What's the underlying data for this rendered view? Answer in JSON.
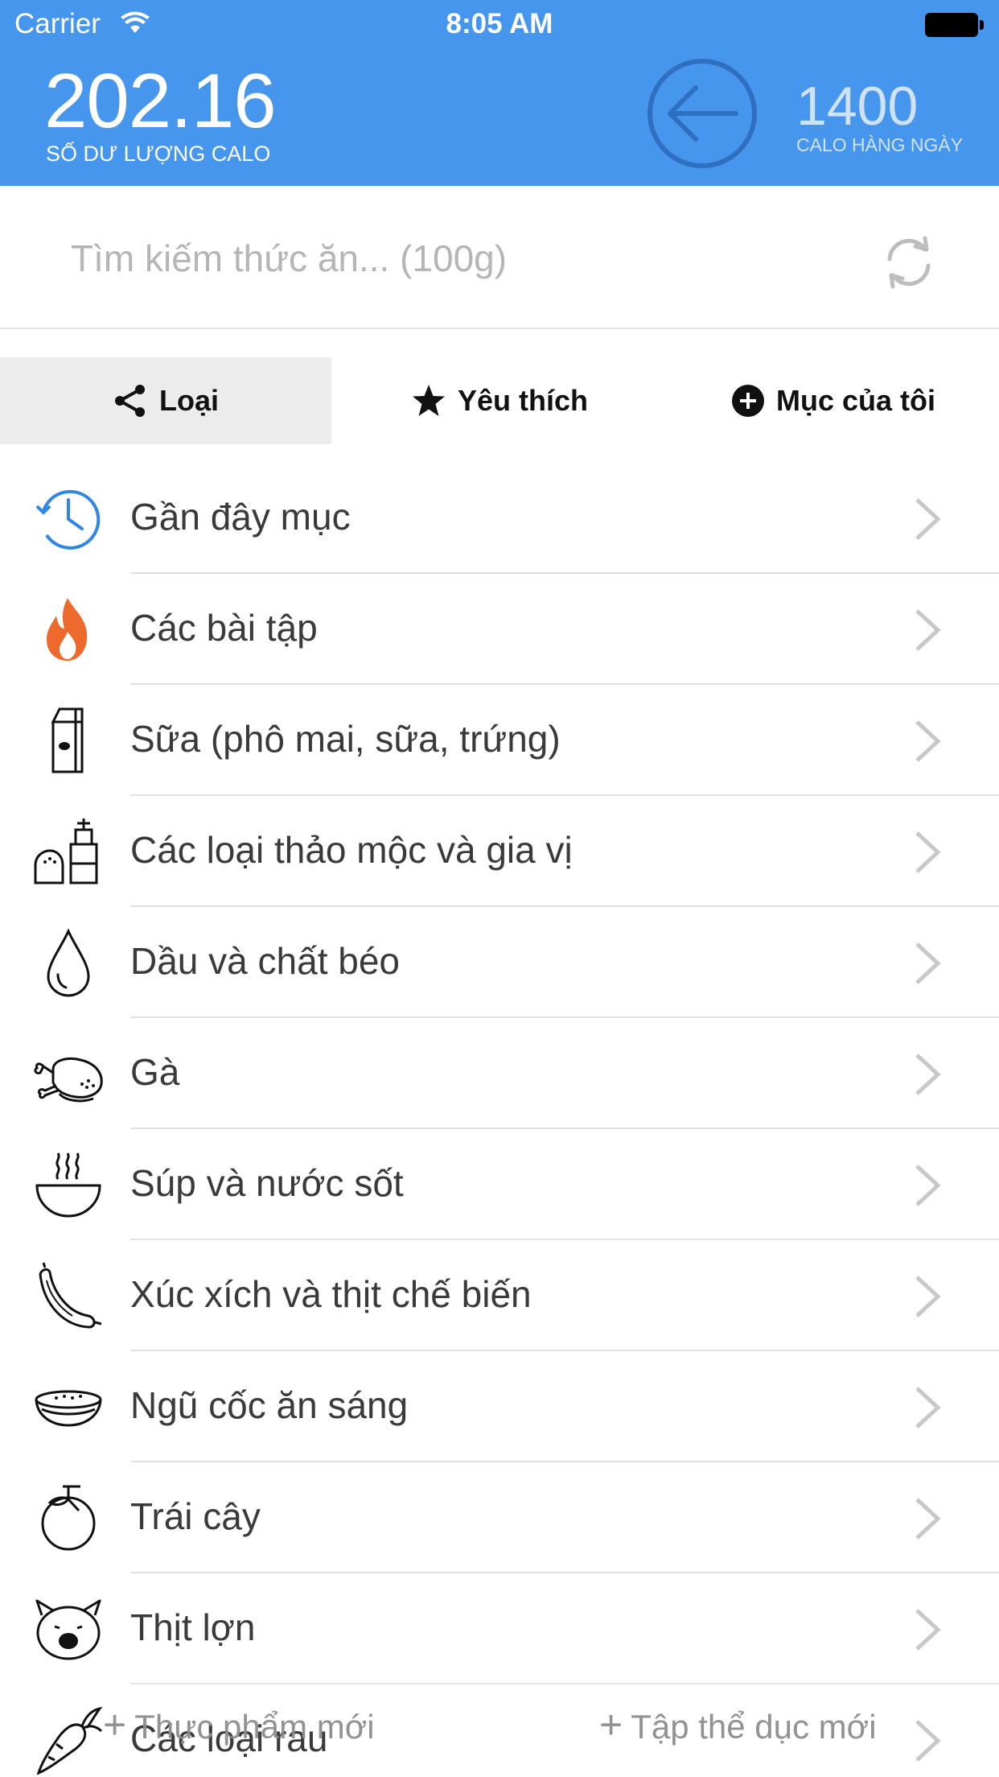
{
  "status_bar": {
    "carrier": "Carrier",
    "time": "8:05 AM"
  },
  "header": {
    "balance_value": "202.16",
    "balance_label": "SỐ DƯ LƯỢNG CALO",
    "daily_value": "1400",
    "daily_label": "CALO HÀNG NGÀY",
    "accent_color": "#4796ee"
  },
  "search": {
    "placeholder": "Tìm kiếm thức ăn... (100g)",
    "value": ""
  },
  "tabs": [
    {
      "label": "Loại",
      "icon": "share-icon",
      "active": true
    },
    {
      "label": "Yêu thích",
      "icon": "star-icon",
      "active": false
    },
    {
      "label": "Mục của tôi",
      "icon": "plus-circle-icon",
      "active": false
    }
  ],
  "categories": [
    {
      "label": "Gần đây mục",
      "icon": "history-clock-icon"
    },
    {
      "label": "Các bài tập",
      "icon": "fire-icon"
    },
    {
      "label": "Sữa (phô mai, sữa, trứng)",
      "icon": "milk-carton-icon"
    },
    {
      "label": "Các loại thảo mộc và gia vị",
      "icon": "spices-icon"
    },
    {
      "label": "Dầu và chất béo",
      "icon": "oil-drop-icon"
    },
    {
      "label": "Gà",
      "icon": "chicken-icon"
    },
    {
      "label": "Súp và nước sốt",
      "icon": "soup-bowl-icon"
    },
    {
      "label": "Xúc xích và thịt chế biến",
      "icon": "sausage-icon"
    },
    {
      "label": "Ngũ cốc ăn sáng",
      "icon": "cereal-bowl-icon"
    },
    {
      "label": "Trái cây",
      "icon": "fruit-icon"
    },
    {
      "label": "Thịt lợn",
      "icon": "pig-icon"
    },
    {
      "label": "Các loại rau",
      "icon": "carrot-icon"
    }
  ],
  "bottom_actions": {
    "new_food": "Thực phẩm mới",
    "new_exercise": "Tập thể dục mới"
  }
}
